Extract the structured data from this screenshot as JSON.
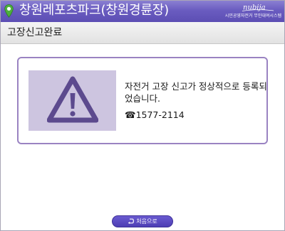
{
  "header": {
    "title": "창원레포츠파크(창원경륜장)",
    "logo_text": "nubija",
    "subtitle": "시민공영자전거 무인대여시스템"
  },
  "subheader": {
    "title": "고장신고완료"
  },
  "notice": {
    "icon": "warning-icon",
    "message": "자전거 고장 신고가 정상적으로 등록되었습니다.",
    "phone": "☎1577-2114"
  },
  "footer": {
    "home_label": "처음으로",
    "home_icon": "return-arrow-icon"
  },
  "colors": {
    "header": "#6a5cc0",
    "accent": "#9a83c2",
    "warning_bg": "#cdc5e0",
    "warning_icon": "#5c4a8e",
    "pin": "#4caf3c"
  }
}
